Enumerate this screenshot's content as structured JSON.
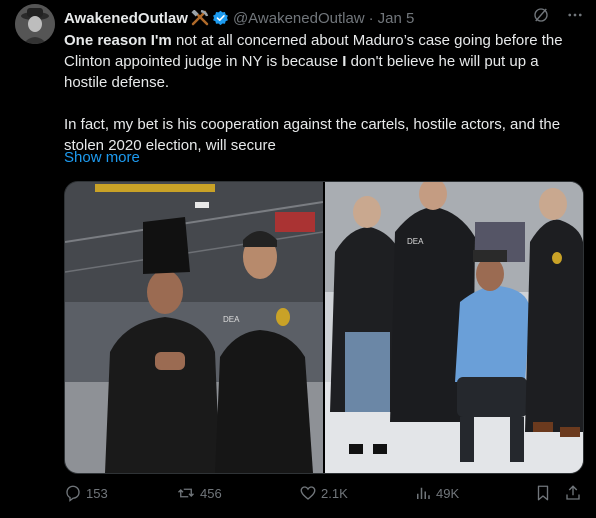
{
  "post": {
    "author_name": "AwakenedOutlaw",
    "handle": "@AwakenedOutlaw",
    "separator": "·",
    "date": "Jan 5",
    "text_p1_bold1": "One reason I'm",
    "text_p1_a": " not at all concerned about Maduro’s case going before the Clinton appointed judge in NY is because ",
    "text_p1_bold2": "I",
    "text_p1_b": " don't believe he will put up a hostile defense.",
    "text_p2": "In fact, my bet is his cooperation against the cartels, hostile actors, and the stolen 2020 election, will secure",
    "show_more": "Show more",
    "accent_color": "#1d9bf0"
  },
  "header_icons": [
    "grok-icon",
    "more-icon"
  ],
  "photos": {
    "left": {
      "patch_text": "DEA"
    },
    "right": {
      "patch_text": "DEA"
    }
  },
  "actions": {
    "replies": "153",
    "reposts": "456",
    "likes": "2.1K",
    "views": "49K"
  },
  "action_icons": [
    "reply-icon",
    "repost-icon",
    "like-icon",
    "views-icon",
    "bookmark-icon",
    "share-icon"
  ]
}
